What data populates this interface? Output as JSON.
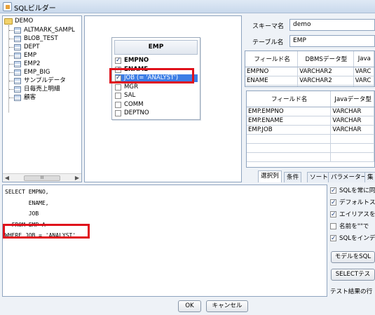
{
  "window": {
    "title": "SQLビルダー"
  },
  "tree": {
    "root": "DEMO",
    "items": [
      "ALTMARK_SAMPL",
      "BLOB_TEST",
      "DEPT",
      "EMP",
      "EMP2",
      "EMP_BIG",
      "サンプルデータ",
      "日毎売上明細",
      "顧客"
    ],
    "scroll_thumb": "III"
  },
  "table_box": {
    "name": "EMP",
    "columns": [
      {
        "label": "EMPNO",
        "checked": true,
        "bold": true
      },
      {
        "label": "ENAME",
        "checked": true,
        "bold": true
      },
      {
        "label": "JOB (= 'ANALYST')",
        "checked": true,
        "bold": false,
        "selected": true
      },
      {
        "label": "MGR",
        "checked": false
      },
      {
        "label": "SAL",
        "checked": false
      },
      {
        "label": "COMM",
        "checked": false
      },
      {
        "label": "DEPTNO",
        "checked": false
      }
    ]
  },
  "properties": {
    "schema_label": "スキーマ名",
    "schema_value": "demo",
    "table_label": "テーブル名",
    "table_value": "EMP",
    "grid1": {
      "headers": [
        "フィールド名",
        "DBMSデータ型",
        "Java"
      ],
      "rows": [
        [
          "EMPNO",
          "VARCHAR2",
          "VARC"
        ],
        [
          "ENAME",
          "VARCHAR2",
          "VARC"
        ]
      ]
    },
    "grid2": {
      "headers": [
        "フィールド名",
        "Javaデータ型"
      ],
      "rows": [
        [
          "EMP.EMPNO",
          "VARCHAR"
        ],
        [
          "EMP.ENAME",
          "VARCHAR"
        ],
        [
          "EMP.JOB",
          "VARCHAR"
        ]
      ]
    },
    "tabs": [
      "選択列",
      "条件",
      "ソート",
      "パラメーター",
      "集"
    ]
  },
  "sql": {
    "lines": [
      "SELECT EMPNO,",
      "       ENAME,",
      "       JOB",
      "  FROM EMP A",
      "WHERE JOB = 'ANALYST'"
    ]
  },
  "options": {
    "checks": [
      "SQLを常に同",
      "デフォルトスキ",
      "エイリアスを付",
      "名前を\"\"で",
      "SQLをインデ"
    ],
    "checked": [
      true,
      true,
      true,
      false,
      true
    ],
    "model_button": "モデルをSQL",
    "select_test_button": "SELECTテス",
    "test_result_label": "テスト結果の行"
  },
  "footer": {
    "ok": "OK",
    "cancel": "キャンセル"
  },
  "colors": {
    "highlight": "#3d7ee6",
    "annotation_box": "#e0111b"
  }
}
